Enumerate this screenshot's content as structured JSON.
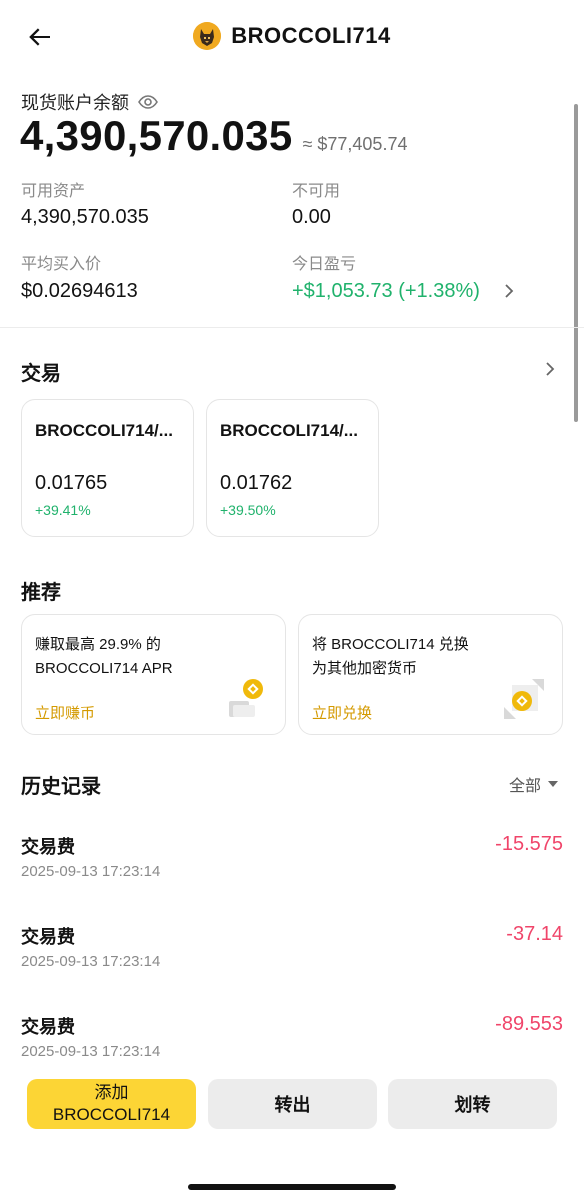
{
  "header": {
    "title": "BROCCOLI714",
    "back_icon": "back-arrow-icon",
    "coin_icon": "broccoli-dog-icon"
  },
  "balance": {
    "label": "现货账户余额",
    "value": "4,390,570.035",
    "usd": "≈ $77,405.74"
  },
  "stats": {
    "available_label": "可用资产",
    "available_value": "4,390,570.035",
    "unavailable_label": "不可用",
    "unavailable_value": "0.00",
    "avg_label": "平均买入价",
    "avg_value": "$0.02694613",
    "pnl_label": "今日盈亏",
    "pnl_value": "+$1,053.73 (+1.38%)"
  },
  "trade": {
    "title": "交易",
    "cards": [
      {
        "pair": "BROCCOLI714/...",
        "price": "0.01765",
        "change": "+39.41%"
      },
      {
        "pair": "BROCCOLI714/...",
        "price": "0.01762",
        "change": "+39.50%"
      }
    ]
  },
  "recommend": {
    "title": "推荐",
    "cards": [
      {
        "line1": "赚取最高 29.9% 的",
        "line2": "BROCCOLI714 APR",
        "link": "立即赚币"
      },
      {
        "line1": "将 BROCCOLI714 兑换",
        "line2": "为其他加密货币",
        "link": "立即兑换"
      }
    ]
  },
  "history": {
    "title": "历史记录",
    "filter": "全部",
    "items": [
      {
        "type": "交易费",
        "date": "2025-09-13 17:23:14",
        "amount": "-15.575"
      },
      {
        "type": "交易费",
        "date": "2025-09-13 17:23:14",
        "amount": "-37.14"
      },
      {
        "type": "交易费",
        "date": "2025-09-13 17:23:14",
        "amount": "-89.553"
      }
    ]
  },
  "actions": {
    "add_line1": "添加",
    "add_line2": "BROCCOLI714",
    "withdraw": "转出",
    "transfer": "划转"
  },
  "colors": {
    "accent_yellow": "#fcd535",
    "profit_green": "#20b26c",
    "loss_red": "#f0456a",
    "link_gold": "#d49a00"
  }
}
